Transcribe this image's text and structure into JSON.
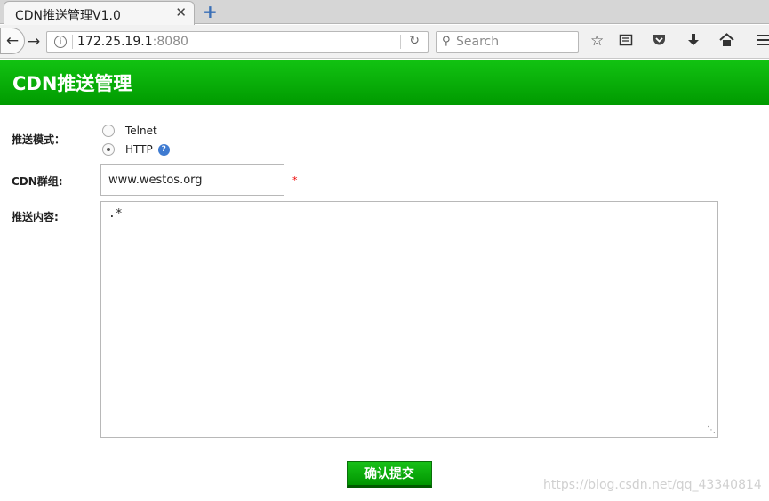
{
  "browser": {
    "tab_title": "CDN推送管理V1.0",
    "tab_close": "✕",
    "new_tab": "+",
    "url_host": "172.25.19.1",
    "url_port": ":8080",
    "search_placeholder": "Search",
    "toolbar_icons": [
      "back-icon",
      "forward-icon",
      "info-icon",
      "reload-icon",
      "search-icon",
      "star-icon",
      "reading-list-icon",
      "pocket-icon",
      "download-icon",
      "home-icon",
      "menu-icon"
    ]
  },
  "page": {
    "title": "CDN推送管理",
    "form": {
      "mode_label": "推送模式：",
      "modes": [
        {
          "label": "Telnet",
          "selected": false
        },
        {
          "label": "HTTP",
          "selected": true
        }
      ],
      "help": "?",
      "group_label": "CDN群组:",
      "group_value": "www.westos.org",
      "required_mark": "*",
      "content_label": "推送内容:",
      "content_value": ".*",
      "submit_label": "确认提交"
    },
    "watermark": "https://blog.csdn.net/qq_43340814"
  },
  "colors": {
    "header_green": "#00b300",
    "button_green": "#009600",
    "required_red": "#e00000",
    "help_blue": "#3f7bd1"
  }
}
